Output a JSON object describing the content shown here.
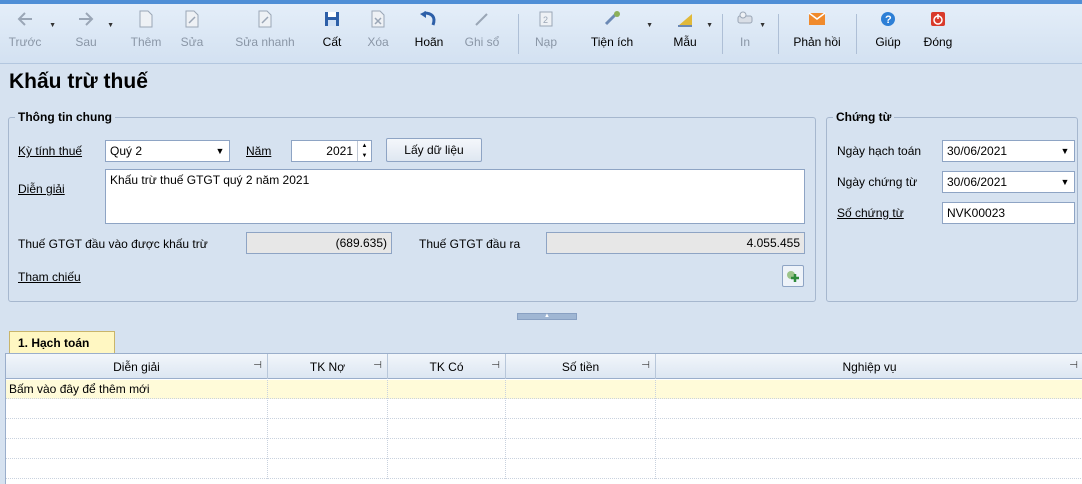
{
  "toolbar": {
    "items": [
      {
        "label": "Trước",
        "icon": "arrow-left-icon",
        "disabled": true,
        "dropdown": true
      },
      {
        "label": "Sau",
        "icon": "arrow-right-icon",
        "disabled": true,
        "dropdown": true
      },
      {
        "label": "Thêm",
        "icon": "add-document-icon",
        "disabled": true
      },
      {
        "label": "Sửa",
        "icon": "edit-document-icon",
        "disabled": true
      },
      {
        "label": "Sửa nhanh",
        "icon": "quick-edit-icon",
        "disabled": true
      },
      {
        "label": "Cất",
        "icon": "save-icon",
        "disabled": false
      },
      {
        "label": "Xóa",
        "icon": "delete-icon",
        "disabled": true
      },
      {
        "label": "Hoãn",
        "icon": "undo-icon",
        "disabled": false
      },
      {
        "label": "Ghi sổ",
        "icon": "pencil-icon",
        "disabled": true
      },
      {
        "label": "Nạp",
        "icon": "reload-icon",
        "disabled": true
      },
      {
        "label": "Tiện ích",
        "icon": "utilities-icon",
        "disabled": false,
        "dropdown": true
      },
      {
        "label": "Mẫu",
        "icon": "template-icon",
        "disabled": false,
        "dropdown": true
      },
      {
        "label": "In",
        "icon": "print-icon",
        "disabled": true,
        "dropdown": true
      },
      {
        "label": "Phản hồi",
        "icon": "feedback-mail-icon",
        "disabled": false
      },
      {
        "label": "Giúp",
        "icon": "help-icon",
        "disabled": false
      },
      {
        "label": "Đóng",
        "icon": "close-power-icon",
        "disabled": false
      }
    ]
  },
  "page_title": "Khấu trừ thuế",
  "general": {
    "legend": "Thông tin chung",
    "period_label": "Kỳ tính thuế",
    "period_value": "Quý 2",
    "year_label": "Năm",
    "year_value": "2021",
    "fetch_button": "Lấy dữ liệu",
    "description_label": "Diễn giải",
    "description_value": "Khấu trừ thuế GTGT quý 2 năm 2021",
    "input_vat_label": "Thuế GTGT đầu vào được khấu trừ",
    "input_vat_value": "(689.635)",
    "output_vat_label": "Thuế GTGT đầu ra",
    "output_vat_value": "4.055.455",
    "reference_label": "Tham chiếu"
  },
  "voucher": {
    "legend": "Chứng từ",
    "posting_date_label": "Ngày hạch toán",
    "posting_date_value": "30/06/2021",
    "voucher_date_label": "Ngày chứng từ",
    "voucher_date_value": "30/06/2021",
    "voucher_no_label": "Số chứng từ",
    "voucher_no_value": "NVK00023"
  },
  "tab": {
    "label": "1. Hạch toán"
  },
  "grid": {
    "columns": [
      "Diễn giải",
      "TK Nợ",
      "TK Có",
      "Số tiền",
      "Nghiệp vụ"
    ],
    "new_row_hint": "Bấm vào đây để thêm mới"
  },
  "colors": {
    "accent": "#4f8fd6",
    "new_row_bg": "#fffbd9",
    "tab_bg": "#fff7c2"
  }
}
